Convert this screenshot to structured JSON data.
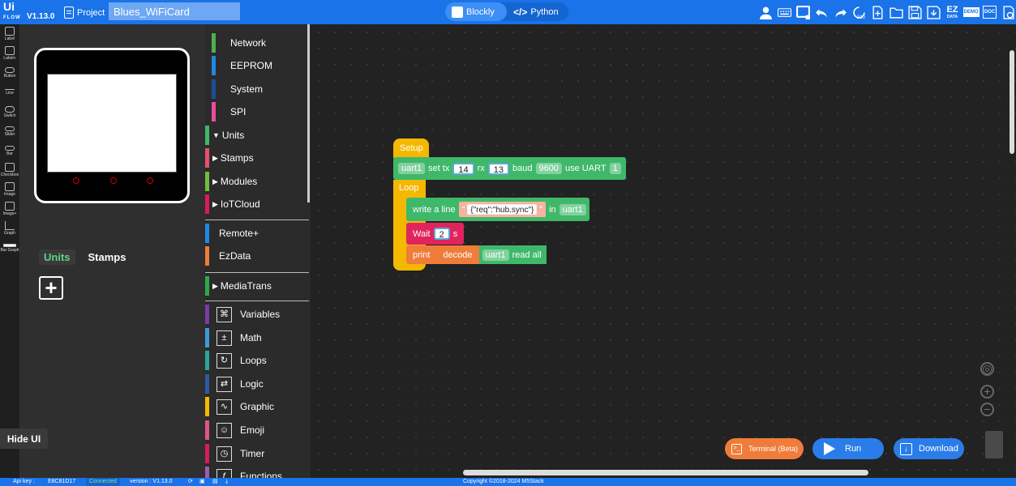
{
  "app": {
    "logo": "Ui",
    "logo_sub": "FLOW",
    "version": "V1.13.0",
    "project_label": "Project",
    "project_name": "Blues_WiFiCard"
  },
  "modes": {
    "blockly": "Blockly",
    "python": "Python"
  },
  "toolbar_icons": [
    "user-icon",
    "keyboard-icon",
    "screen-icon",
    "undo-icon",
    "redo-icon",
    "timer-100-icon",
    "new-file-icon",
    "open-folder-icon",
    "save-icon",
    "download-save-icon",
    "ezdata-icon",
    "demo-icon",
    "doc-icon",
    "settings-icon"
  ],
  "toolbar_text": {
    "ez": "EZ",
    "data": "DATA",
    "demo": "DEMO",
    "doc": "DOC",
    "timer": "100"
  },
  "left_tools": [
    "Label",
    "Label+",
    "Button",
    "Line",
    "Switch",
    "Slider",
    "Bar",
    "Checkbox",
    "Image",
    "Image+",
    "Graph",
    "Bar Graph"
  ],
  "preview": {
    "tab_units": "Units",
    "tab_stamps": "Stamps",
    "add": "+",
    "hide_ui": "Hide UI"
  },
  "categories": {
    "top": [
      {
        "label": "Network",
        "color": "#4caf50"
      },
      {
        "label": "EEPROM",
        "color": "#1e88e5"
      },
      {
        "label": "System",
        "color": "#1e4c9a"
      },
      {
        "label": "SPI",
        "color": "#e84f9b"
      }
    ],
    "tri": [
      {
        "label": "Units",
        "color": "#3fb86a"
      },
      {
        "label": "Stamps",
        "color": "#e84f6b"
      },
      {
        "label": "Modules",
        "color": "#6fbf3a"
      },
      {
        "label": "IoTCloud",
        "color": "#d81b60"
      }
    ],
    "ext": [
      {
        "label": "Remote+",
        "color": "#1e88e5"
      },
      {
        "label": "EzData",
        "color": "#f07c3a"
      }
    ],
    "media": {
      "label": "MediaTrans",
      "color": "#2ea84a"
    },
    "basic": [
      {
        "label": "Variables",
        "color": "#7b3aa8",
        "icon": "⌘"
      },
      {
        "label": "Math",
        "color": "#3a9ad9",
        "icon": "±"
      },
      {
        "label": "Loops",
        "color": "#2ba59b",
        "icon": "↻"
      },
      {
        "label": "Logic",
        "color": "#2c5aa0",
        "icon": "⇄"
      },
      {
        "label": "Graphic",
        "color": "#f5b800",
        "icon": "∿"
      },
      {
        "label": "Emoji",
        "color": "#e0528c",
        "icon": "☺"
      },
      {
        "label": "Timer",
        "color": "#d81b60",
        "icon": "◷"
      },
      {
        "label": "Functions",
        "color": "#9c5bb5",
        "icon": "ƒ"
      }
    ]
  },
  "blocks": {
    "setup": "Setup",
    "uart_set": {
      "dd": "uart1",
      "set": "set tx",
      "tx": "14",
      "rx_label": "rx",
      "rx": "13",
      "baud_label": "baud",
      "baud": "9600",
      "use": "use UART",
      "uart_num": "1"
    },
    "loop": "Loop",
    "write": {
      "label": "write a line",
      "quote_l": "“",
      "value": "{\"req\":\"hub.sync\"}",
      "quote_r": "”",
      "in": "in",
      "dd": "uart1"
    },
    "wait": {
      "label": "Wait",
      "value": "2",
      "unit": "s"
    },
    "print": {
      "label": "print",
      "decode": "decode",
      "dd": "uart1",
      "read": "read all"
    }
  },
  "actions": {
    "terminal": "Terminal (Beta)",
    "run": "Run",
    "download": "Download"
  },
  "footer": {
    "api_key_label": "Api key :",
    "api_key": "E8C81D17",
    "status": "Connected",
    "version": "version : V1.13.0",
    "copyright": "Copyright ©2018-2024 M5Stack"
  },
  "colors": {
    "accent": "#1a73e8",
    "setup": "#f5b800",
    "uart": "#3fb86a",
    "wait": "#e0245e",
    "print": "#f07c3a",
    "terminal": "#f07c3a",
    "run": "#2a7de8"
  }
}
